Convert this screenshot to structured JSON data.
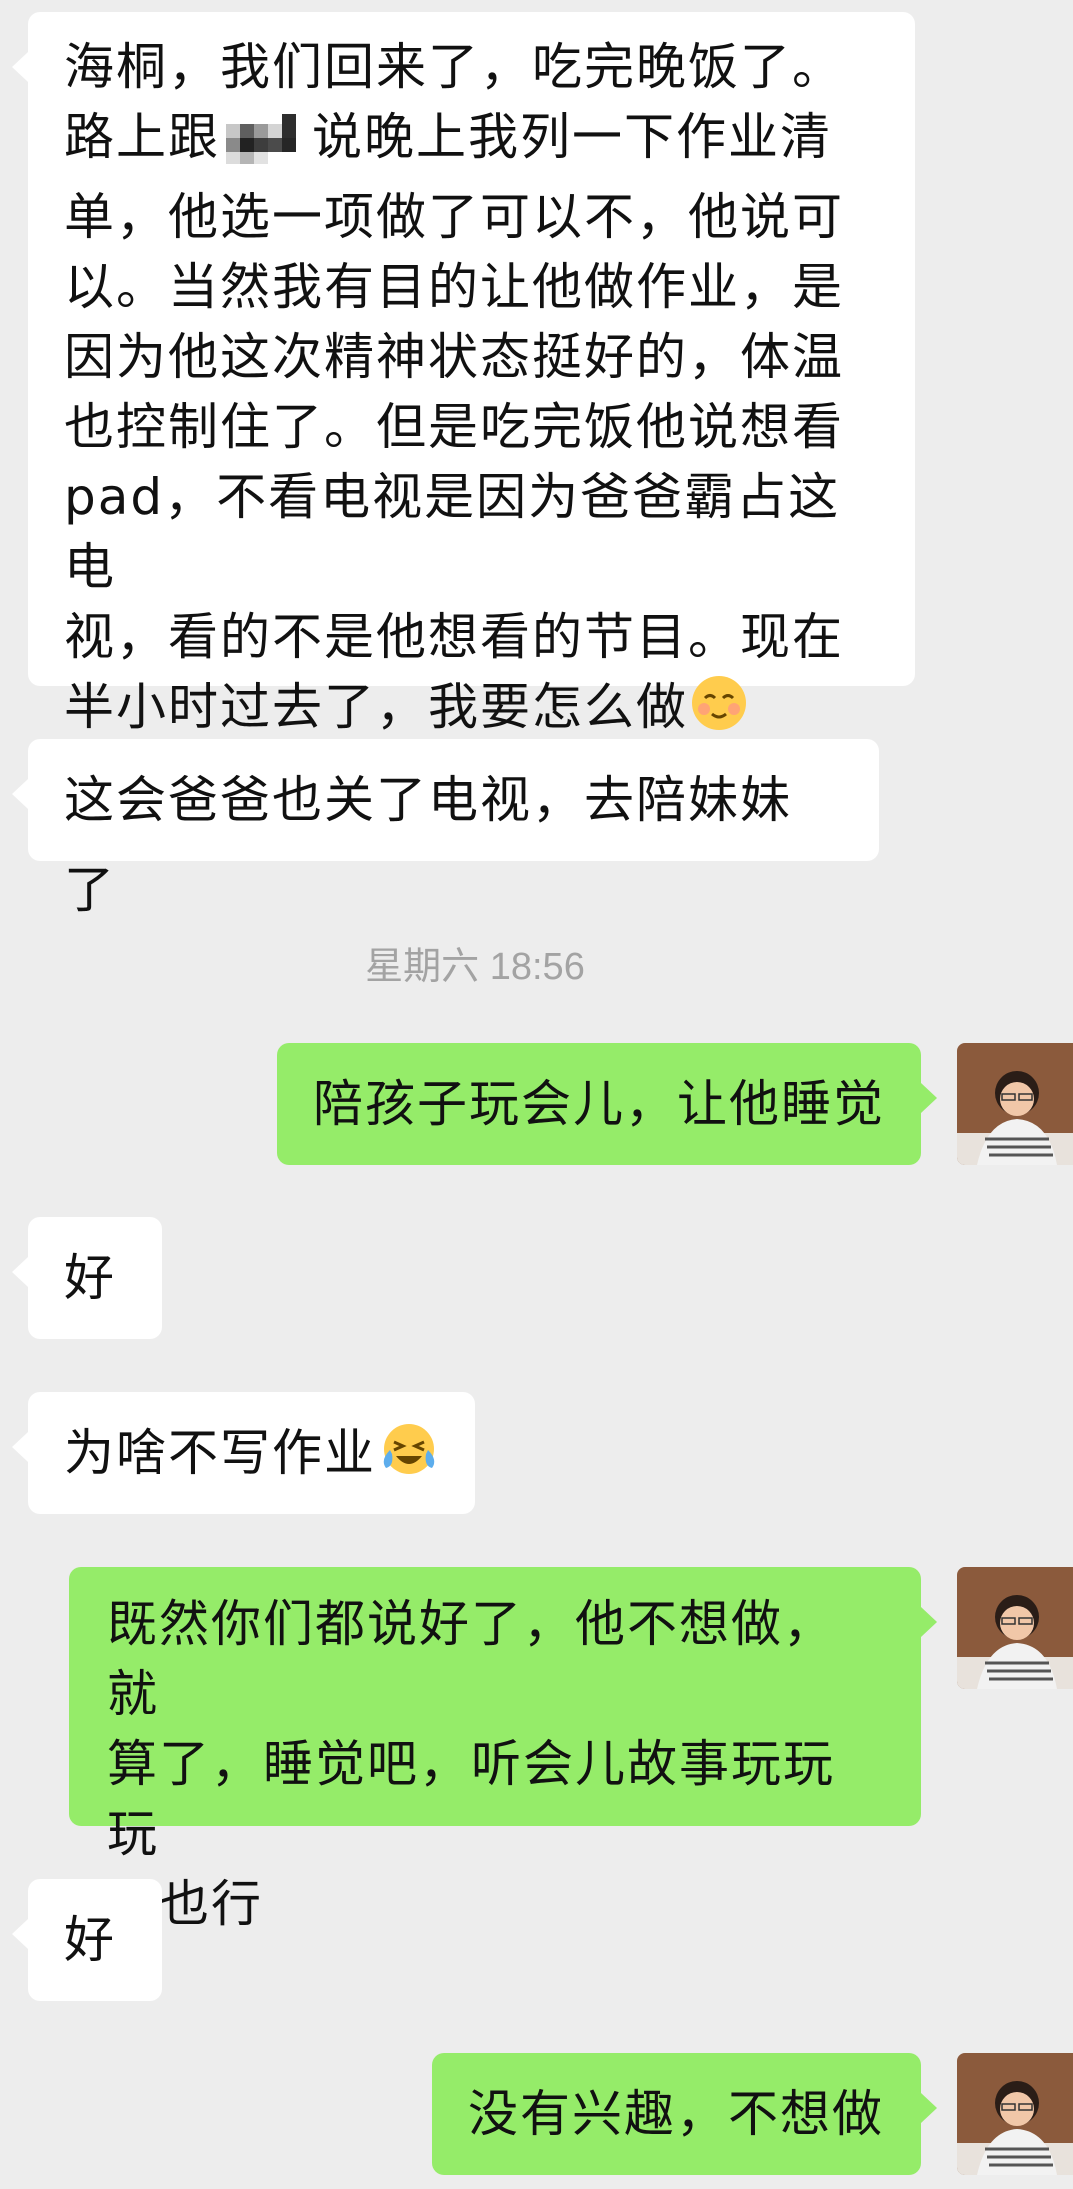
{
  "chat": {
    "timestamp": "星期六 18:56",
    "m1": {
      "l1": "海桐，我们回来了，吃完晚饭了。",
      "l2a": "路上跟",
      "l2b": "说晚上我列一下作业清",
      "l3": "单，他选一项做了可以不，他说可",
      "l4": "以。当然我有目的让他做作业，是",
      "l5": "因为他这次精神状态挺好的，体温",
      "l6": "也控制住了。但是吃完饭他说想看",
      "l7": "pad，不看电视是因为爸爸霸占这电",
      "l8": "视，看的不是他想看的节目。现在",
      "l9": "半小时过去了，我要怎么做"
    },
    "m2": "这会爸爸也关了电视，去陪妹妹了",
    "m3": "陪孩子玩会儿，让他睡觉",
    "m4": "好",
    "m5": "为啥不写作业",
    "m6": {
      "l1": "既然你们都说好了，他不想做，就",
      "l2": "算了，睡觉吧，听会儿故事玩玩玩",
      "l3": "具也行"
    },
    "m7": "好",
    "m8": "没有兴趣，不想做"
  },
  "icons": {
    "m1_end": "blushing-smile-emoji",
    "m5_end": "crying-laughing-emoji",
    "mosaic": "blurred-name-mosaic",
    "avatar": "user-avatar-photo"
  },
  "colors": {
    "background": "#ededed",
    "incoming_bubble": "#ffffff",
    "outgoing_bubble": "#95ec69",
    "timestamp_text": "#a3a3a3"
  }
}
